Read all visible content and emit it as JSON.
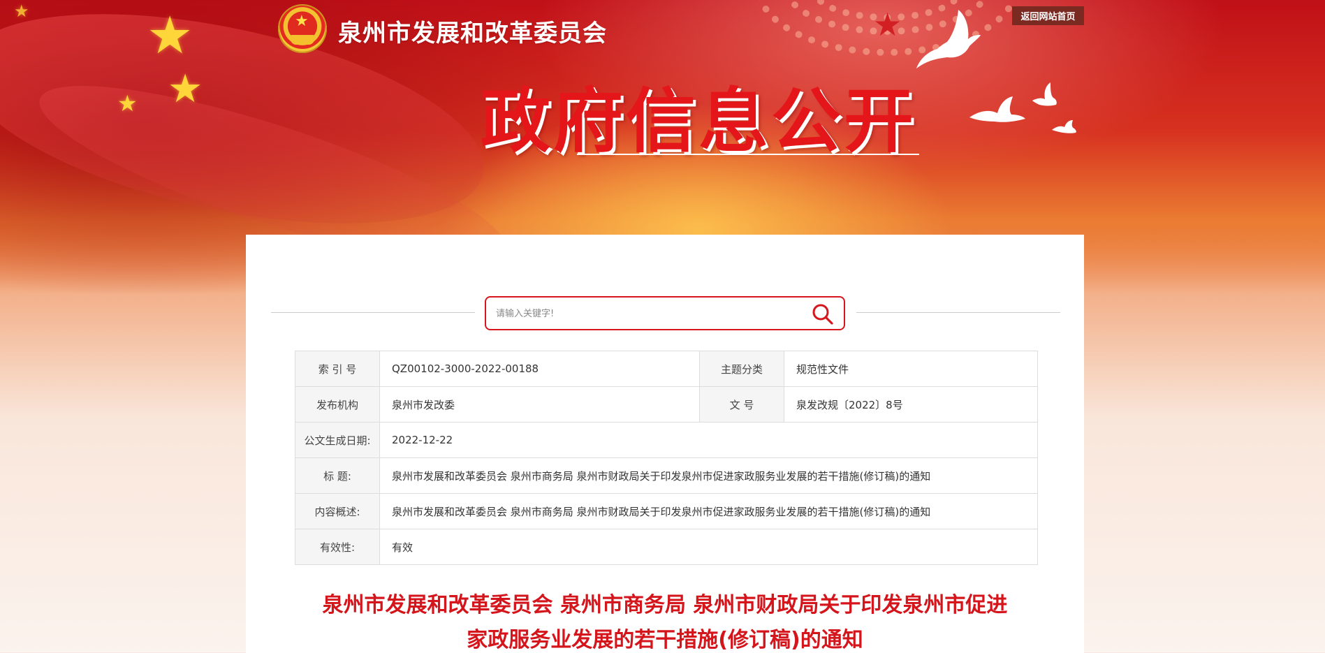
{
  "header": {
    "site_title": "泉州市发展和改革委员会",
    "return_link": "返回网站首页",
    "banner_title": "政府信息公开",
    "emblem": "national-emblem-icon"
  },
  "search": {
    "placeholder": "请输入关键字!",
    "value": "",
    "icon": "search-icon"
  },
  "info": {
    "index_label": "索 引 号",
    "index_value": "QZ00102-3000-2022-00188",
    "topic_label": "主题分类",
    "topic_value": "规范性文件",
    "publisher_label": "发布机构",
    "publisher_value": "泉州市发改委",
    "docno_label": "文 号",
    "docno_value": "泉发改规〔2022〕8号",
    "date_label": "公文生成日期:",
    "date_value": "2022-12-22",
    "title_label": "标 题:",
    "title_value": "泉州市发展和改革委员会 泉州市商务局 泉州市财政局关于印发泉州市促进家政服务业发展的若干措施(修订稿)的通知",
    "summary_label": "内容概述:",
    "summary_value": "泉州市发展和改革委员会 泉州市商务局 泉州市财政局关于印发泉州市促进家政服务业发展的若干措施(修订稿)的通知",
    "validity_label": "有效性:",
    "validity_value": "有效"
  },
  "document": {
    "title_line1": "泉州市发展和改革委员会 泉州市商务局 泉州市财政局关于印发泉州市促进",
    "title_line2": "家政服务业发展的若干措施(修订稿)的通知"
  },
  "colors": {
    "accent_red": "#d4161c",
    "banner_red": "#c5121a",
    "return_bg": "#7a2a20"
  }
}
